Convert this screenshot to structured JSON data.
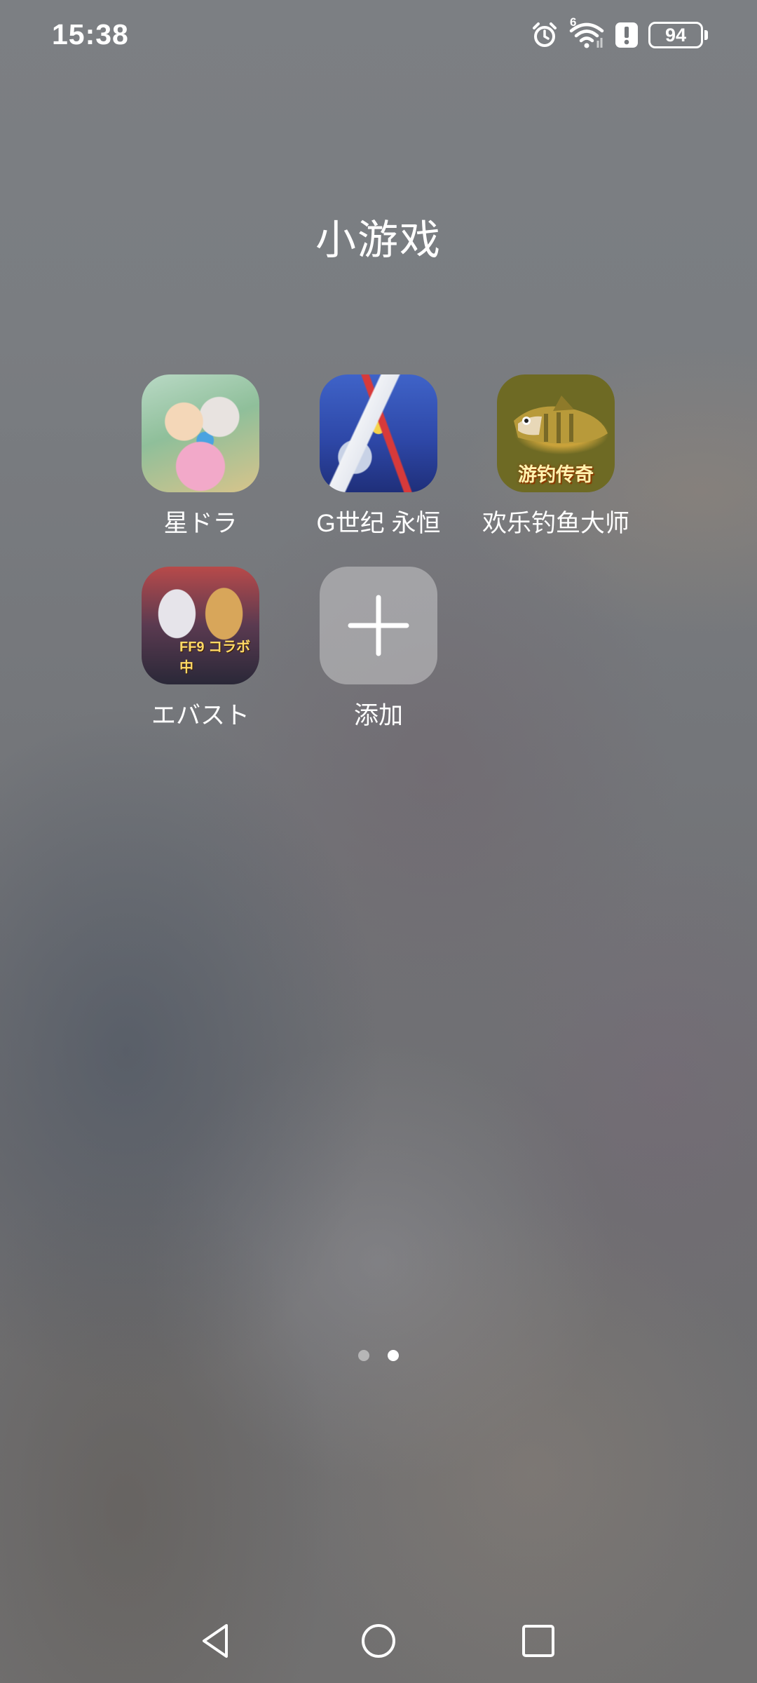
{
  "status_bar": {
    "time": "15:38",
    "wifi_badge": "6",
    "battery_level": "94",
    "icons": [
      "alarm-icon",
      "wifi-icon",
      "alert-icon",
      "battery-icon"
    ]
  },
  "folder": {
    "title": "小游戏"
  },
  "apps": [
    {
      "label": "星ドラ",
      "icon": "hoshi-dora-icon"
    },
    {
      "label": "G世纪 永恒",
      "icon": "g-generation-icon"
    },
    {
      "label": "欢乐钓鱼大师",
      "icon": "fishing-master-icon",
      "banner": "游钓传奇"
    },
    {
      "label": "エバスト",
      "icon": "eba-story-icon",
      "badge": "FF9 コラボ中"
    },
    {
      "label": "添加",
      "icon": "plus-icon"
    }
  ],
  "pager": {
    "pages": 2,
    "current": 2
  },
  "nav_bar": {
    "buttons": [
      "back-icon",
      "home-icon",
      "recents-icon"
    ]
  },
  "colors": {
    "text": "#ffffff",
    "add_tile": "#c8c8ca"
  }
}
